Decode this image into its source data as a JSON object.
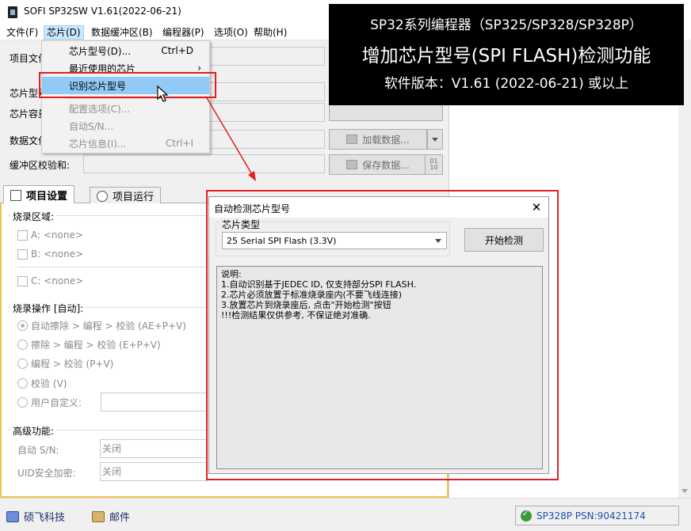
{
  "window": {
    "title": "SOFI SP32SW V1.61(2022-06-21)"
  },
  "menubar": {
    "items": [
      "文件(F)",
      "芯片(D)",
      "数据缓冲区(B)",
      "编程器(P)",
      "选项(O)",
      "帮助(H)"
    ]
  },
  "chip_menu": {
    "items": [
      {
        "label": "芯片型号(D)...",
        "shortcut": "Ctrl+D"
      },
      {
        "label": "最近使用的芯片",
        "shortcut": "›"
      },
      {
        "label": "识别芯片型号",
        "shortcut": ""
      },
      {
        "label": "配置选项(C)...",
        "shortcut": ""
      },
      {
        "label": "自动S/N...",
        "shortcut": ""
      },
      {
        "label": "芯片信息(I)...",
        "shortcut": "Ctrl+I"
      }
    ]
  },
  "form": {
    "project_file_label": "项目文件",
    "chip_model_label": "芯片型号",
    "chip_capacity_label": "芯片容量",
    "data_file_label": "数据文件",
    "buffer_checksum_label": "缓冲区校验和:",
    "load_data_button": "加载数据...",
    "save_data_button": "保存数据..."
  },
  "tabs": [
    "项目设置",
    "项目运行"
  ],
  "burn_area": {
    "title": "烧录区域:",
    "items": [
      "A: <none>",
      "B: <none>",
      "C: <none>"
    ]
  },
  "burn_ops": {
    "title": "烧录操作 [自动]:",
    "options": [
      "自动擦除 > 编程 > 校验 (AE+P+V)",
      "擦除 > 编程 > 校验 (E+P+V)",
      "编程 > 校验 (P+V)",
      "校验 (V)",
      "用户自定义:"
    ],
    "selected_index": 0
  },
  "advanced": {
    "title": "高级功能:",
    "auto_sn_label": "自动 S/N:",
    "auto_sn_value": "关闭",
    "uid_label": "UID安全加密:",
    "uid_value": "关闭"
  },
  "statusbar": {
    "company_link": "硕飞科技",
    "mail_link": "邮件",
    "device_status": "SP328P  PSN:90421174"
  },
  "banner": {
    "line1": "SP32系列编程器（SP325/SP328/SP328P）",
    "line2": "增加芯片型号(SPI FLASH)检测功能",
    "line3": "软件版本：V1.61 (2022-06-21) 或以上"
  },
  "dialog": {
    "title": "自动检测芯片型号",
    "close": "✕",
    "chip_type_label": "芯片类型",
    "chip_type_value": "25 Serial SPI Flash (3.3V)",
    "start_button": "开始检测",
    "description": [
      "说明:",
      "1.自动识别基于JEDEC ID, 仅支持部分SPI FLASH.",
      "2.芯片必须放置于标准烧录座内(不要飞线连接)",
      "3.放置芯片到烧录座后, 点击\"开始检测\"按钮",
      "!!!检测结果仅供参考, 不保证绝对准确."
    ]
  },
  "colors": {
    "highlight_frame": "#e02020",
    "menu_highlight": "#91c9f7",
    "tab_accent": "#f0c24f",
    "banner_bg": "#000000",
    "status_text": "#1f4fb0"
  }
}
